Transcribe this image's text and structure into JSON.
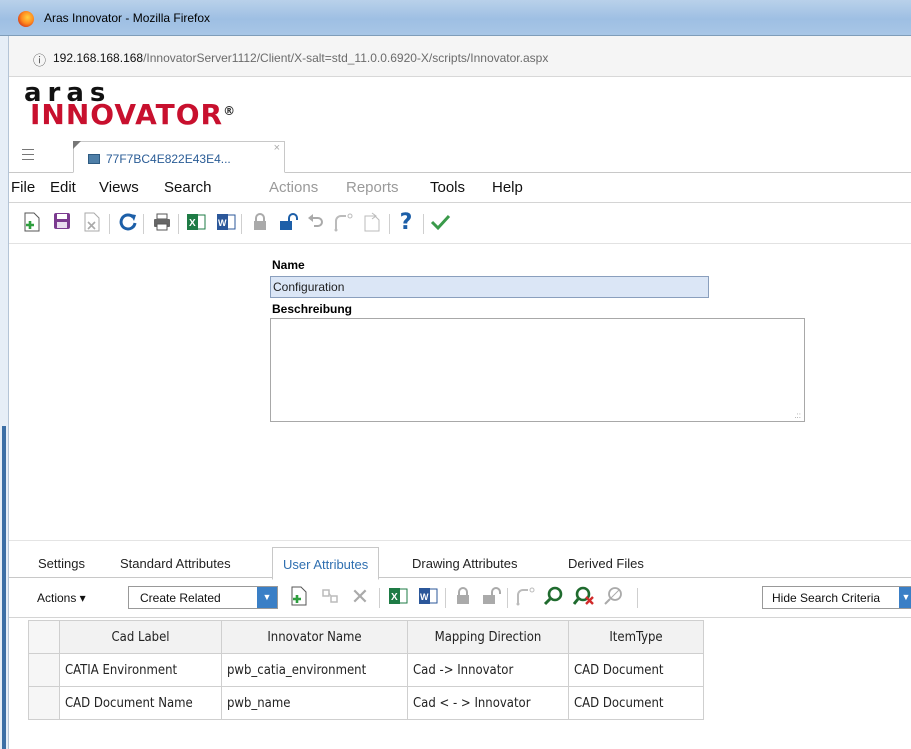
{
  "window": {
    "title": "Aras Innovator - Mozilla Firefox"
  },
  "browser": {
    "url_host": "192.168.168.168",
    "url_path": "/InnovatorServer1112/Client/X-salt=std_11.0.0.6920-X/scripts/Innovator.aspx"
  },
  "logo": {
    "line1": "aras",
    "line2": "INNOVATOR",
    "reg": "®"
  },
  "tabs": [
    {
      "label": "77F7BC4E822E43E4...",
      "close": "×"
    }
  ],
  "menu": [
    {
      "label": "File",
      "enabled": true
    },
    {
      "label": "Edit",
      "enabled": true
    },
    {
      "label": "Views",
      "enabled": true
    },
    {
      "label": "Search",
      "enabled": true
    },
    {
      "label": "Actions",
      "enabled": false
    },
    {
      "label": "Reports",
      "enabled": false
    },
    {
      "label": "Tools",
      "enabled": true
    },
    {
      "label": "Help",
      "enabled": true
    }
  ],
  "toolbar_icons": [
    "new-item-icon",
    "save-icon",
    "discard-icon",
    "refresh-icon",
    "print-icon",
    "export-excel-icon",
    "export-word-icon",
    "lock-icon",
    "unlock-icon",
    "undo-icon",
    "promote-icon",
    "version-icon",
    "help-icon",
    "done-icon"
  ],
  "form": {
    "name_label": "Name",
    "name_value": "Configuration",
    "desc_label": "Beschreibung",
    "desc_value": ""
  },
  "relationship_tabs": [
    {
      "label": "Settings",
      "active": false
    },
    {
      "label": "Standard Attributes",
      "active": false
    },
    {
      "label": "User Attributes",
      "active": true
    },
    {
      "label": "Drawing Attributes",
      "active": false
    },
    {
      "label": "Derived Files",
      "active": false
    }
  ],
  "rel_toolbar": {
    "actions_label": "Actions ▾",
    "create_related_label": "Create Related",
    "hide_search_label": "Hide Search Criteria"
  },
  "grid": {
    "columns": [
      "Cad Label",
      "Innovator Name",
      "Mapping Direction",
      "ItemType"
    ],
    "rows": [
      [
        "CATIA Environment",
        "pwb_catia_environment",
        "Cad -> Innovator",
        "CAD Document"
      ],
      [
        "CAD Document Name",
        "pwb_name",
        "Cad < - > Innovator",
        "CAD Document"
      ]
    ]
  },
  "colors": {
    "accent": "#2f6fb0",
    "brand_red": "#c8102e",
    "name_field_bg": "#dbe6f6"
  }
}
